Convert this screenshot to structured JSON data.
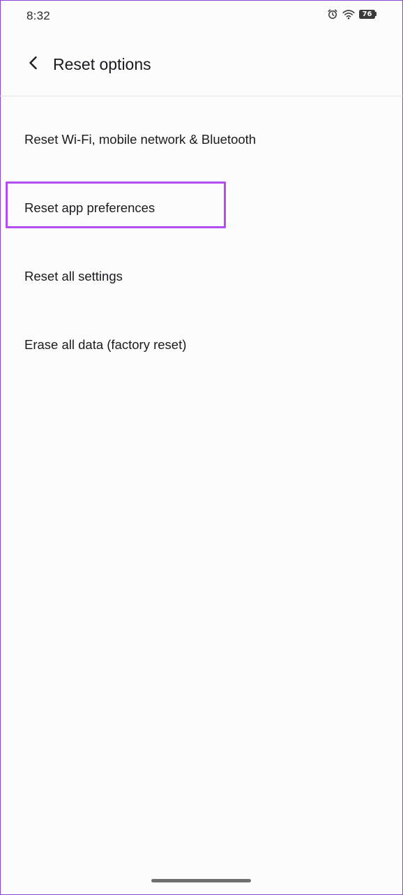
{
  "status_bar": {
    "time": "8:32",
    "icons": [
      "alarm-icon",
      "wifi-icon",
      "battery-icon"
    ],
    "battery_level": "76"
  },
  "app_bar": {
    "back_icon": "chevron-left-icon",
    "title": "Reset options"
  },
  "options": [
    {
      "label": "Reset Wi-Fi, mobile network & Bluetooth"
    },
    {
      "label": "Reset app preferences",
      "highlighted": true
    },
    {
      "label": "Reset all settings"
    },
    {
      "label": "Erase all data (factory reset)"
    }
  ],
  "colors": {
    "background": "#fdfcfc",
    "text": "#1b1b1f",
    "highlight": "#b24df0",
    "frame": "#8a45d6"
  }
}
